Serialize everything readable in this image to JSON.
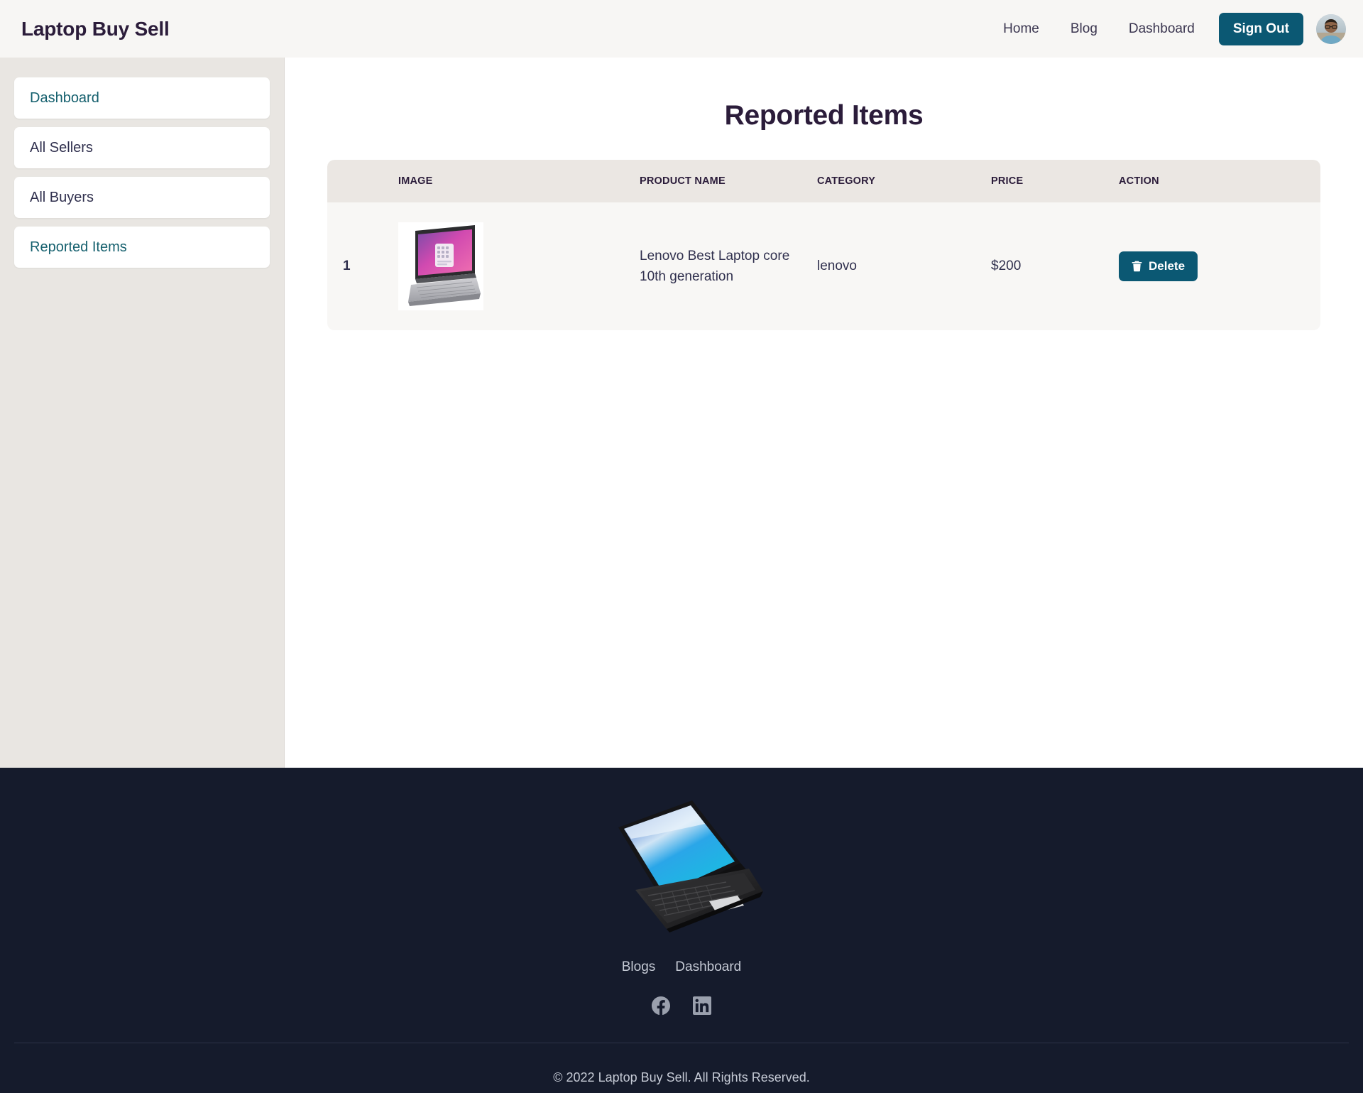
{
  "navbar": {
    "brand": "Laptop Buy Sell",
    "links": [
      {
        "label": "Home"
      },
      {
        "label": "Blog"
      },
      {
        "label": "Dashboard"
      }
    ],
    "signout_label": "Sign Out",
    "avatar_name": "user-avatar"
  },
  "sidebar": {
    "items": [
      {
        "label": "Dashboard",
        "state": "active"
      },
      {
        "label": "All Sellers",
        "state": "normal"
      },
      {
        "label": "All Buyers",
        "state": "normal"
      },
      {
        "label": "Reported Items",
        "state": "active"
      }
    ]
  },
  "main": {
    "title": "Reported Items",
    "table": {
      "columns": [
        "",
        "IMAGE",
        "PRODUCT NAME",
        "CATEGORY",
        "PRICE",
        "ACTION"
      ],
      "rows": [
        {
          "index": "1",
          "image_alt": "Lenovo laptop product photo",
          "product_name": "Lenovo Best Laptop core 10th generation",
          "category": "lenovo",
          "price": "$200",
          "action_label": "Delete"
        }
      ]
    }
  },
  "footer": {
    "logo_alt": "laptop-logo",
    "links": [
      {
        "label": "Blogs"
      },
      {
        "label": "Dashboard"
      }
    ],
    "socials": [
      {
        "name": "facebook-icon"
      },
      {
        "name": "linkedin-icon"
      }
    ],
    "copyright": "© 2022 Laptop Buy Sell. All Rights Reserved."
  },
  "colors": {
    "accent": "#0B5873",
    "brand_text": "#2B1C3A",
    "active_link": "#15606E",
    "sidebar_bg": "#E9E6E2",
    "footer_bg": "#151B2C",
    "table_head_bg": "#EBE7E3",
    "table_row_bg": "#F8F7F5"
  }
}
